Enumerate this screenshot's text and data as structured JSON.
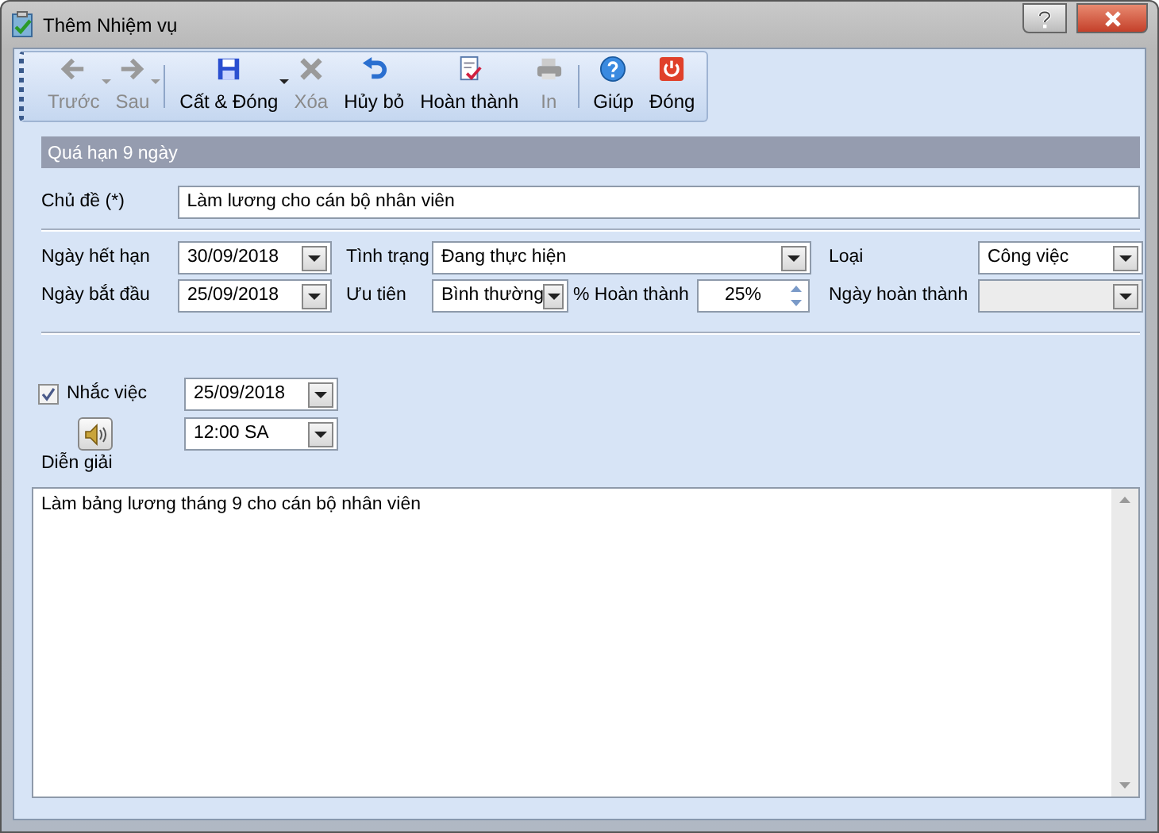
{
  "window": {
    "title": "Thêm Nhiệm vụ"
  },
  "toolbar": [
    {
      "kind": "button",
      "label": "Trước",
      "disabled": true,
      "dropdown": true
    },
    {
      "kind": "button",
      "label": "Sau",
      "disabled": true,
      "dropdown": true
    },
    {
      "kind": "separator"
    },
    {
      "kind": "button",
      "label": "Cất & Đóng",
      "disabled": false,
      "dropdown": true
    },
    {
      "kind": "button",
      "label": "Xóa",
      "disabled": true,
      "dropdown": false
    },
    {
      "kind": "button",
      "label": "Hủy bỏ",
      "disabled": false,
      "dropdown": false
    },
    {
      "kind": "button",
      "label": "Hoàn thành",
      "disabled": false,
      "dropdown": false
    },
    {
      "kind": "button",
      "label": "In",
      "disabled": true,
      "dropdown": false
    },
    {
      "kind": "separator"
    },
    {
      "kind": "button",
      "label": "Giúp",
      "disabled": false,
      "dropdown": false
    },
    {
      "kind": "button",
      "label": "Đóng",
      "disabled": false,
      "dropdown": false
    }
  ],
  "banner": "Quá hạn 9 ngày",
  "subject": {
    "label": "Chủ đề (*)",
    "value": "Làm lương cho cán bộ nhân viên"
  },
  "rows": [
    [
      {
        "kind": "label",
        "text": "Ngày hết hạn"
      },
      {
        "kind": "combo",
        "value": "30/09/2018",
        "disabled": false
      },
      {
        "kind": "label",
        "text": "Tình trạng"
      },
      {
        "kind": "combo",
        "value": "Đang thực hiện",
        "disabled": false
      },
      {
        "kind": "label",
        "text": "Loại"
      },
      {
        "kind": "combo",
        "value": "Công việc",
        "disabled": false
      }
    ],
    [
      {
        "kind": "label",
        "text": "Ngày bắt đầu"
      },
      {
        "kind": "combo",
        "value": "25/09/2018",
        "disabled": false
      },
      {
        "kind": "label",
        "text": "Ưu tiên"
      },
      {
        "kind": "combo",
        "value": "Bình thường",
        "disabled": false
      },
      {
        "kind": "label",
        "text": "% Hoàn thành"
      },
      {
        "kind": "spin",
        "value": "25%"
      },
      {
        "kind": "label",
        "text": "Ngày hoàn thành"
      },
      {
        "kind": "combo",
        "disabled": true
      }
    ]
  ],
  "reminder": {
    "label": "Nhắc việc",
    "checked": true,
    "date": "25/09/2018",
    "time": "12:00 SA"
  },
  "description": {
    "label": "Diễn giải",
    "value": "Làm bảng lương tháng 9 cho cán bộ nhân viên"
  }
}
